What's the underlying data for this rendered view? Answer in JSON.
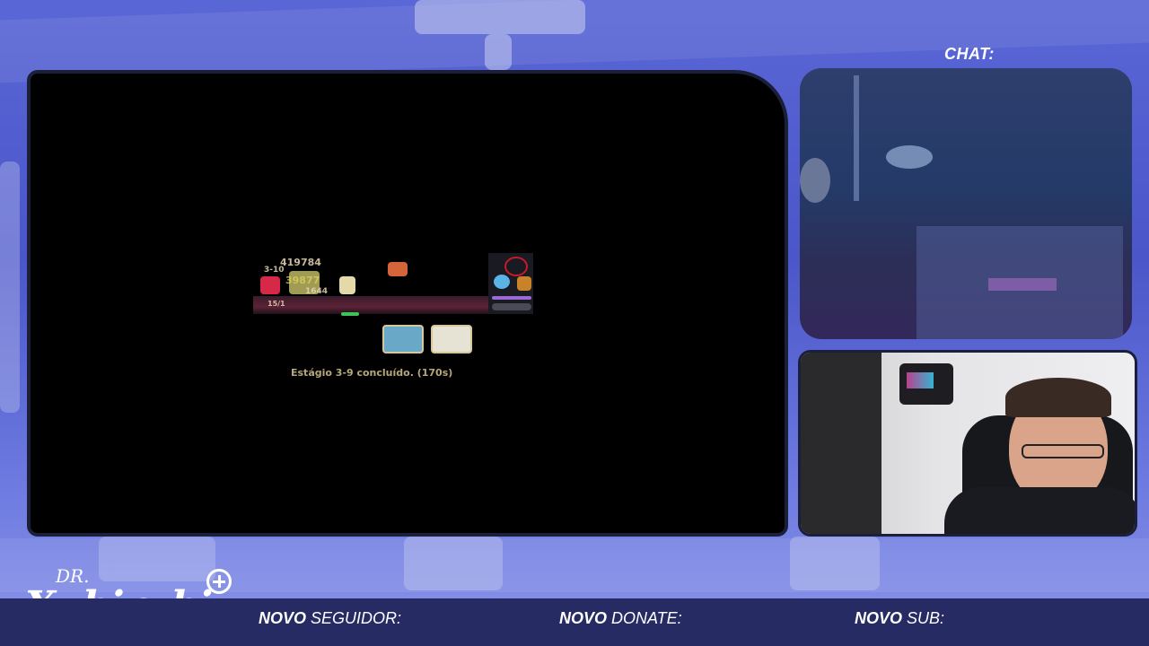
{
  "chat": {
    "title": "CHAT:"
  },
  "game": {
    "status_text": "Estágio 3-9 concluído. (170s)",
    "damage_numbers": [
      "419784",
      "3-10",
      "39877",
      "1644",
      "15/1"
    ]
  },
  "branding": {
    "prefix": "DR.",
    "name": "Xubirubi"
  },
  "alerts": [
    {
      "bold": "NOVO",
      "rest": " SEGUIDOR:"
    },
    {
      "bold": "NOVO",
      "rest": " DONATE:"
    },
    {
      "bold": "NOVO",
      "rest": " SUB:"
    }
  ],
  "colors": {
    "accent": "#5a67d6",
    "bar": "#262b63",
    "frame": "#1c1f3a",
    "status_text": "#b6a77a"
  }
}
